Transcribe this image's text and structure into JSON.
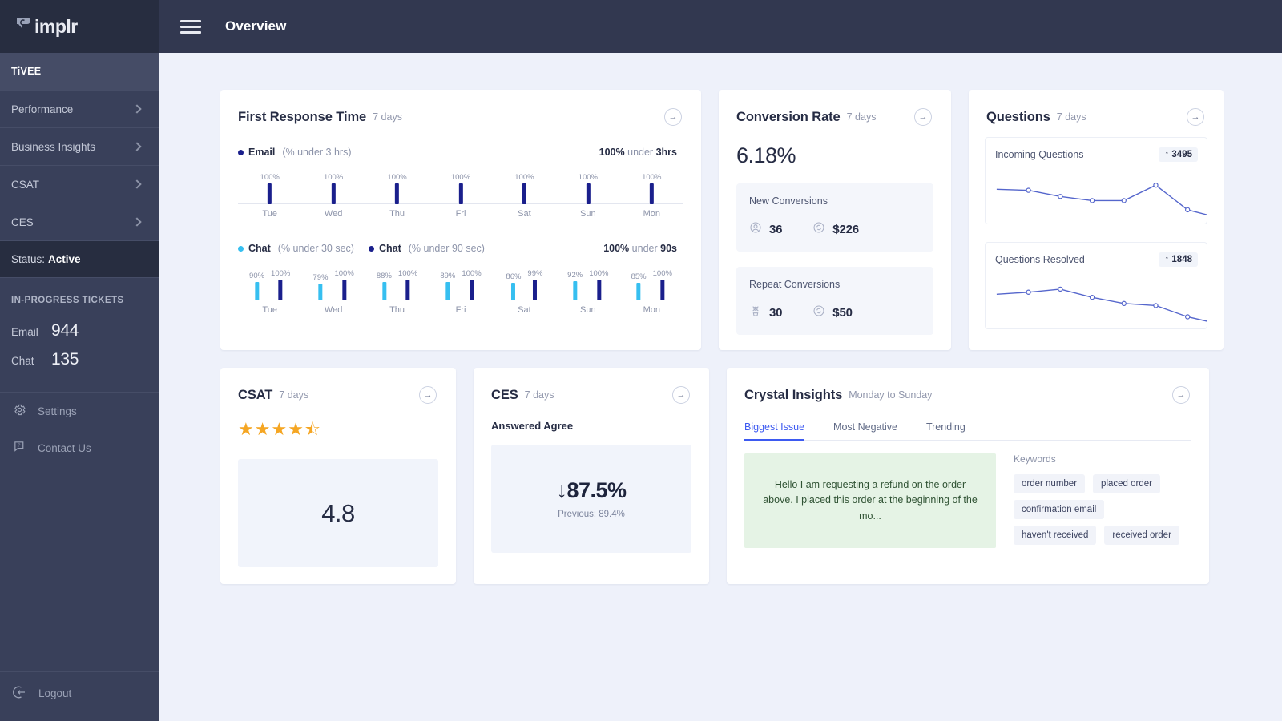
{
  "brand": {
    "logo_text": "implr",
    "logo_icon": "simplr-chat-bubble-icon"
  },
  "sidebar": {
    "account": "TiVEE",
    "nav": [
      {
        "label": "Performance"
      },
      {
        "label": "Business Insights"
      },
      {
        "label": "CSAT"
      },
      {
        "label": "CES"
      }
    ],
    "status_label": "Status:",
    "status_value": "Active",
    "tickets_heading": "IN-PROGRESS TICKETS",
    "tickets": [
      {
        "label": "Email",
        "count": "944"
      },
      {
        "label": "Chat",
        "count": "135"
      }
    ],
    "links": [
      {
        "label": "Settings",
        "icon": "gear-icon"
      },
      {
        "label": "Contact Us",
        "icon": "chat-help-icon"
      }
    ],
    "logout": {
      "label": "Logout",
      "icon": "logout-icon"
    }
  },
  "topbar": {
    "title": "Overview",
    "menu_icon": "hamburger-icon"
  },
  "colors": {
    "navy": "#1a1f8c",
    "cyan": "#36bff0",
    "accent_blue": "#3d5af1",
    "star_gold": "#f5a623",
    "quote_green": "#e5f3e5"
  },
  "cards": {
    "first_response_time": {
      "title": "First Response Time",
      "period": "7 days",
      "arrow": "arrow-right-icon",
      "email": {
        "legend_name": "Email",
        "legend_qualifier": "(% under 3 hrs)",
        "summary_value": "100%",
        "summary_mid": "under",
        "summary_unit": "3hrs"
      },
      "chat": {
        "legend1_name": "Chat",
        "legend1_qualifier": "(% under 30 sec)",
        "legend2_name": "Chat",
        "legend2_qualifier": "(% under 90 sec)",
        "summary_value": "100%",
        "summary_mid": "under",
        "summary_unit": "90s"
      }
    },
    "conversion_rate": {
      "title": "Conversion Rate",
      "period": "7 days",
      "rate": "6.18%",
      "new": {
        "label": "New Conversions",
        "count_icon": "user-circle-icon",
        "count": "36",
        "amount_icon": "refresh-dollar-icon",
        "amount": "$226"
      },
      "repeat": {
        "label": "Repeat Conversions",
        "count_icon": "repeat-user-icon",
        "count": "30",
        "amount_icon": "refresh-dollar-icon",
        "amount": "$50"
      }
    },
    "questions": {
      "title": "Questions",
      "period": "7 days",
      "incoming": {
        "label": "Incoming Questions",
        "trend_arrow": "↑",
        "value": "3495"
      },
      "resolved": {
        "label": "Questions Resolved",
        "trend_arrow": "↑",
        "value": "1848"
      }
    },
    "csat": {
      "title": "CSAT",
      "period": "7 days",
      "stars_filled": 4,
      "stars_half": 1,
      "stars_total": 5,
      "score": "4.8"
    },
    "ces": {
      "title": "CES",
      "period": "7 days",
      "metric_label": "Answered Agree",
      "trend_arrow": "↓",
      "value": "87.5%",
      "previous": "Previous: 89.4%"
    },
    "crystal_insights": {
      "title": "Crystal Insights",
      "period": "Monday to Sunday",
      "tabs": [
        {
          "label": "Biggest Issue",
          "active": true
        },
        {
          "label": "Most Negative",
          "active": false
        },
        {
          "label": "Trending",
          "active": false
        }
      ],
      "quote": "Hello I am requesting a refund on the order above. I placed this order at the beginning of the mo...",
      "keywords_title": "Keywords",
      "keywords": [
        "order number",
        "placed order",
        "confirmation email",
        "haven't received",
        "received order"
      ]
    }
  },
  "chart_data": [
    {
      "type": "bar",
      "title": "First Response Time — Email (% under 3 hrs)",
      "categories": [
        "Tue",
        "Wed",
        "Thu",
        "Fri",
        "Sat",
        "Sun",
        "Mon"
      ],
      "series": [
        {
          "name": "Email (% under 3 hrs)",
          "color": "#1a1f8c",
          "values": [
            100,
            100,
            100,
            100,
            100,
            100,
            100
          ],
          "labels": [
            "100%",
            "100%",
            "100%",
            "100%",
            "100%",
            "100%",
            "100%"
          ]
        }
      ],
      "ylim": [
        0,
        100
      ],
      "ylabel": "",
      "xlabel": "",
      "grid": false,
      "legend": "top-left"
    },
    {
      "type": "bar",
      "title": "First Response Time — Chat",
      "categories": [
        "Tue",
        "Wed",
        "Thu",
        "Fri",
        "Sat",
        "Sun",
        "Mon"
      ],
      "series": [
        {
          "name": "Chat (% under 30 sec)",
          "color": "#36bff0",
          "values": [
            90,
            79,
            88,
            89,
            86,
            92,
            85
          ],
          "labels": [
            "90%",
            "79%",
            "88%",
            "89%",
            "86%",
            "92%",
            "85%"
          ]
        },
        {
          "name": "Chat (% under 90 sec)",
          "color": "#1a1f8c",
          "values": [
            100,
            100,
            100,
            100,
            99,
            100,
            100
          ],
          "labels": [
            "100%",
            "100%",
            "100%",
            "100%",
            "99%",
            "100%",
            "100%"
          ]
        }
      ],
      "ylim": [
        0,
        100
      ],
      "ylabel": "",
      "xlabel": "",
      "grid": false,
      "legend": "top-left"
    },
    {
      "type": "line",
      "title": "Incoming Questions",
      "total": 3495,
      "x": [
        1,
        2,
        3,
        4,
        5,
        6,
        7,
        8
      ],
      "values": [
        62,
        60,
        48,
        40,
        40,
        70,
        22,
        6
      ],
      "color": "#5566cc",
      "markers": true,
      "grid": false
    },
    {
      "type": "line",
      "title": "Questions Resolved",
      "total": 1848,
      "x": [
        1,
        2,
        3,
        4,
        5,
        6,
        7,
        8
      ],
      "values": [
        62,
        66,
        72,
        56,
        44,
        40,
        18,
        4
      ],
      "color": "#5566cc",
      "markers": true,
      "grid": false
    }
  ]
}
